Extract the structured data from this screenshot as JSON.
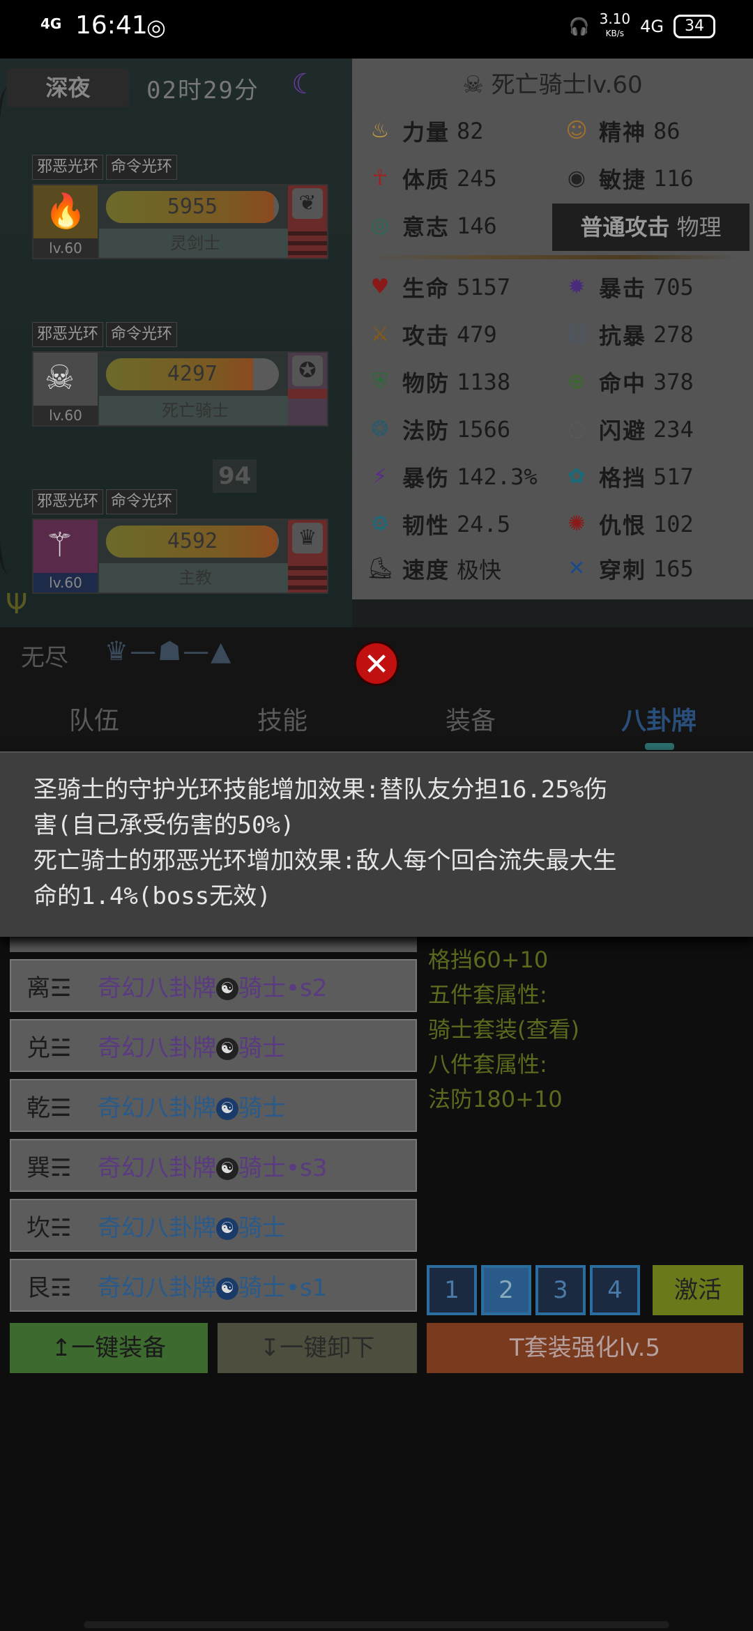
{
  "status_bar": {
    "signal": "4G",
    "time": "16:41",
    "speed": "3.10",
    "speed_unit": "KB/s",
    "network": "4G",
    "battery": "34"
  },
  "left_panel": {
    "night_label": "深夜",
    "timer": "02时29分",
    "characters": [
      {
        "auras": [
          "邪恶光环",
          "命令光环"
        ],
        "hp": "5955",
        "hp_fraction": 0.97,
        "name": "灵剑士",
        "level": "lv.60",
        "portrait_color": "#5a4a20",
        "badge_color": "#6a2a2a"
      },
      {
        "auras": [
          "邪恶光环",
          "命令光环"
        ],
        "hp": "4297",
        "hp_fraction": 0.85,
        "name": "死亡骑士",
        "level": "lv.60",
        "portrait_color": "#4a4a4a",
        "badge_color": "#4a3a4a"
      },
      {
        "auras": [
          "邪恶光环",
          "命令光环"
        ],
        "hp": "4592",
        "hp_fraction": 0.99,
        "name": "主教",
        "level": "lv.60",
        "portrait_color": "#5a2a4a",
        "badge_color": "#6a2a2a"
      }
    ],
    "counter": "94"
  },
  "stats": {
    "title": "死亡骑士lv.60",
    "attributes": [
      {
        "label": "力量",
        "value": "82",
        "icon": "flame-icon",
        "color": "#c8a040"
      },
      {
        "label": "精神",
        "value": "86",
        "icon": "head-icon",
        "color": "#a07030"
      },
      {
        "label": "体质",
        "value": "245",
        "icon": "body-icon",
        "color": "#a02020"
      },
      {
        "label": "敏捷",
        "value": "116",
        "icon": "eye-icon",
        "color": "#222222"
      },
      {
        "label": "意志",
        "value": "146",
        "icon": "target-icon",
        "color": "#2a6a5a"
      }
    ],
    "attack_type_label": "普通攻击",
    "attack_type_value": "物理",
    "combat": [
      {
        "label": "生命",
        "value": "5157",
        "icon": "heart-icon",
        "color": "#8a1a1a"
      },
      {
        "label": "暴击",
        "value": "705",
        "icon": "crit-icon",
        "color": "#4a2a7a"
      },
      {
        "label": "攻击",
        "value": "479",
        "icon": "sword-icon",
        "color": "#8a5a10"
      },
      {
        "label": "抗暴",
        "value": "278",
        "icon": "resist-icon",
        "color": "#4a5a6a"
      },
      {
        "label": "物防",
        "value": "1138",
        "icon": "shield-icon",
        "color": "#2a6a3a"
      },
      {
        "label": "命中",
        "value": "378",
        "icon": "crosshair-icon",
        "color": "#3a6a2a"
      },
      {
        "label": "法防",
        "value": "1566",
        "icon": "magic-shield-icon",
        "color": "#2a5a6a"
      },
      {
        "label": "闪避",
        "value": "234",
        "icon": "swirl-icon",
        "color": "#5a5a5a"
      },
      {
        "label": "暴伤",
        "value": "142.3%",
        "icon": "bolt-icon",
        "color": "#5a2a8a"
      },
      {
        "label": "格挡",
        "value": "517",
        "icon": "block-icon",
        "color": "#1a6a7a"
      },
      {
        "label": "韧性",
        "value": "24.5",
        "icon": "gear-icon",
        "color": "#1a6a7a"
      },
      {
        "label": "仇恨",
        "value": "102",
        "icon": "anger-icon",
        "color": "#8a1a1a"
      },
      {
        "label": "速度",
        "value": "极快",
        "icon": "boot-icon",
        "color": "#1a1a1a"
      },
      {
        "label": "穿刺",
        "value": "165",
        "icon": "pierce-icon",
        "color": "#1a4a8a"
      }
    ]
  },
  "header": {
    "mode": "无尽",
    "chain": "♛—☗—▲"
  },
  "tabs": [
    "队伍",
    "技能",
    "装备",
    "八卦牌"
  ],
  "tooltip": {
    "line1": "圣骑士的守护光环技能增加效果:替队友分担16.25%伤",
    "line2": "害(自己承受伤害的50%)",
    "line3": "死亡骑士的邪恶光环增加效果:敌人每个回合流失最大生",
    "line4": "命的1.4%(boss无效)"
  },
  "cards": [
    {
      "trigram": "离☲",
      "name": "奇幻八卦牌",
      "suffix": "骑士•s2",
      "color": "purple"
    },
    {
      "trigram": "兑☱",
      "name": "奇幻八卦牌",
      "suffix": "骑士",
      "color": "purple"
    },
    {
      "trigram": "乾☰",
      "name": "奇幻八卦牌",
      "suffix": "骑士",
      "color": "blue"
    },
    {
      "trigram": "巽☴",
      "name": "奇幻八卦牌",
      "suffix": "骑士•s3",
      "color": "purple"
    },
    {
      "trigram": "坎☵",
      "name": "奇幻八卦牌",
      "suffix": "骑士",
      "color": "blue"
    },
    {
      "trigram": "艮☶",
      "name": "奇幻八卦牌",
      "suffix": "骑士•s1",
      "color": "blue"
    }
  ],
  "set_info": {
    "line1": "格挡60+10",
    "line2": "五件套属性:",
    "line3": "骑士套装(查看)",
    "line4": "八件套属性:",
    "line5": "法防180+10"
  },
  "slots": [
    "1",
    "2",
    "3",
    "4"
  ],
  "buttons": {
    "activate": "激活",
    "equip_all": "↥一键装备",
    "unequip_all": "↧一键卸下",
    "enhance": "T套装强化lv.5"
  }
}
